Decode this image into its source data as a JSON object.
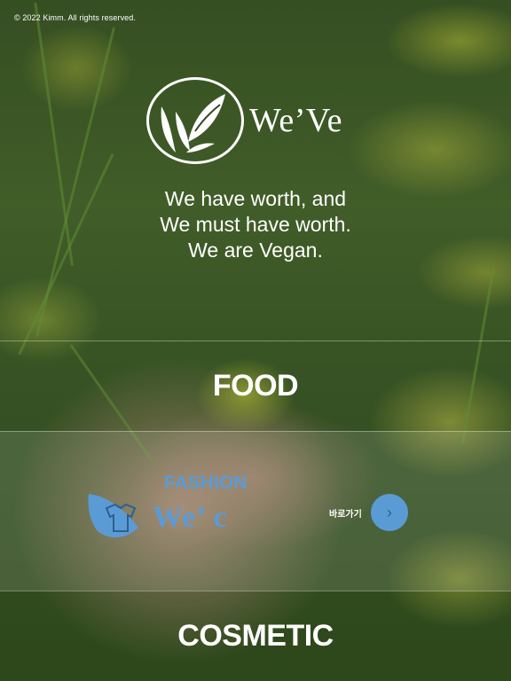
{
  "copyright": "© 2022 Kimm. All rights reserved.",
  "brand": {
    "logo_icon": "leaf-w-emblem",
    "name": "We’Ve"
  },
  "tagline": [
    "We have worth, and",
    "We must have worth.",
    "We are Vegan."
  ],
  "categories": {
    "food": "FOOD",
    "fashion": {
      "title": "FASHION",
      "logo_icon": "tshirt-leaf-icon",
      "logo_text": "We’ c",
      "goto_label": "바로가기",
      "goto_icon": "chevron-right-icon"
    },
    "cosmetic": "COSMETIC"
  },
  "colors": {
    "accent": "#5b9bd5",
    "text": "#ffffff"
  }
}
